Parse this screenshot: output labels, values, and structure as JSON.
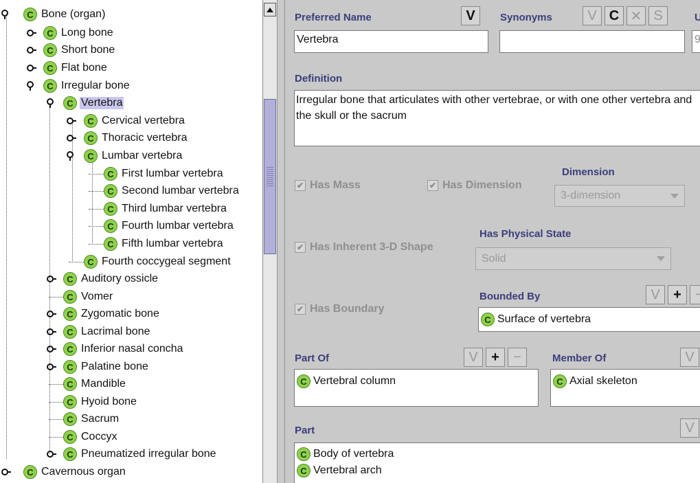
{
  "tree": {
    "rows": [
      {
        "label": "Bone (organ)"
      },
      {
        "label": "Long bone"
      },
      {
        "label": "Short bone"
      },
      {
        "label": "Flat bone"
      },
      {
        "label": "Irregular bone"
      },
      {
        "label": "Vertebra"
      },
      {
        "label": "Cervical vertebra"
      },
      {
        "label": "Thoracic vertebra"
      },
      {
        "label": "Lumbar vertebra"
      },
      {
        "label": "First lumbar vertebra"
      },
      {
        "label": "Second lumbar vertebra"
      },
      {
        "label": "Third lumbar vertebra"
      },
      {
        "label": "Fourth lumbar vertebra"
      },
      {
        "label": "Fifth lumbar vertebra"
      },
      {
        "label": "Fourth coccygeal segment"
      },
      {
        "label": "Auditory ossicle"
      },
      {
        "label": "Vomer"
      },
      {
        "label": "Zygomatic bone"
      },
      {
        "label": "Lacrimal bone"
      },
      {
        "label": "Inferior nasal concha"
      },
      {
        "label": "Palatine bone"
      },
      {
        "label": "Mandible"
      },
      {
        "label": "Hyoid bone"
      },
      {
        "label": "Sacrum"
      },
      {
        "label": "Coccyx"
      },
      {
        "label": "Pneumatized irregular bone"
      },
      {
        "label": "Cavernous organ"
      }
    ],
    "class_glyph": "C"
  },
  "form": {
    "preferred_name": {
      "label": "Preferred Name",
      "value": "Vertebra",
      "button": "V"
    },
    "synonyms": {
      "label": "Synonyms",
      "value": "",
      "buttons": [
        "V",
        "C",
        "✕",
        "S"
      ]
    },
    "clipped_label": "U",
    "clipped_value": "9",
    "definition": {
      "label": "Definition",
      "value": "Irregular bone that articulates with other vertebrae, or with one other vertebra and the skull or the sacrum"
    },
    "has_mass": "Has Mass",
    "has_dimension": "Has Dimension",
    "dimension": {
      "label": "Dimension",
      "value": "3-dimension"
    },
    "has_inherent_shape": "Has Inherent 3-D Shape",
    "has_physical_state": {
      "label": "Has Physical State",
      "value": "Solid"
    },
    "has_boundary": "Has Boundary",
    "bounded_by": {
      "label": "Bounded By",
      "items": [
        "Surface of vertebra"
      ],
      "buttons": [
        "V",
        "+",
        "−"
      ]
    },
    "part_of": {
      "label": "Part Of",
      "items": [
        "Vertebral column"
      ],
      "buttons": [
        "V",
        "+",
        "−"
      ]
    },
    "member_of": {
      "label": "Member Of",
      "items": [
        "Axial skeleton"
      ],
      "buttons": [
        "V"
      ]
    },
    "part": {
      "label": "Part",
      "items": [
        "Body of vertebra",
        "Vertebral arch"
      ],
      "buttons": [
        "V"
      ]
    }
  }
}
